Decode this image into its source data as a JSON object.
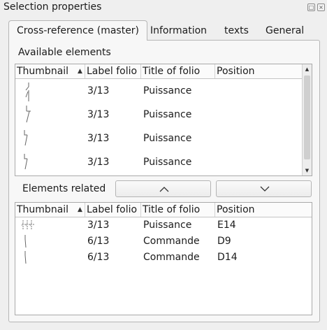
{
  "window": {
    "title": "Selection properties",
    "float_icon": "float-icon",
    "close_icon": "close-icon"
  },
  "tabs": [
    {
      "label": "Cross-reference (master)",
      "active": true
    },
    {
      "label": "Information",
      "active": false
    },
    {
      "label": "texts",
      "active": false
    },
    {
      "label": "General",
      "active": false
    }
  ],
  "available": {
    "group_label": "Available elements",
    "columns": [
      "Thumbnail",
      "Label folio",
      "Title of folio",
      "Position"
    ],
    "sorted_column": "Thumbnail",
    "rows": [
      {
        "thumbnail": "contact-symbol",
        "label_folio": "3/13",
        "title": "Puissance",
        "position": ""
      },
      {
        "thumbnail": "contact-symbol",
        "label_folio": "3/13",
        "title": "Puissance",
        "position": ""
      },
      {
        "thumbnail": "contact-symbol",
        "label_folio": "3/13",
        "title": "Puissance",
        "position": ""
      },
      {
        "thumbnail": "contact-symbol",
        "label_folio": "3/13",
        "title": "Puissance",
        "position": ""
      }
    ]
  },
  "related": {
    "group_label": "Elements related",
    "up_icon": "chevron-up-icon",
    "down_icon": "chevron-down-icon",
    "columns": [
      "Thumbnail",
      "Label folio",
      "Title of folio",
      "Position"
    ],
    "sorted_column": "Thumbnail",
    "rows": [
      {
        "thumbnail": "triple-contact-symbol",
        "label_folio": "3/13",
        "title": "Puissance",
        "position": "E14"
      },
      {
        "thumbnail": "contact-symbol",
        "label_folio": "6/13",
        "title": "Commande",
        "position": "D9"
      },
      {
        "thumbnail": "contact-symbol",
        "label_folio": "6/13",
        "title": "Commande",
        "position": "D14"
      }
    ]
  }
}
